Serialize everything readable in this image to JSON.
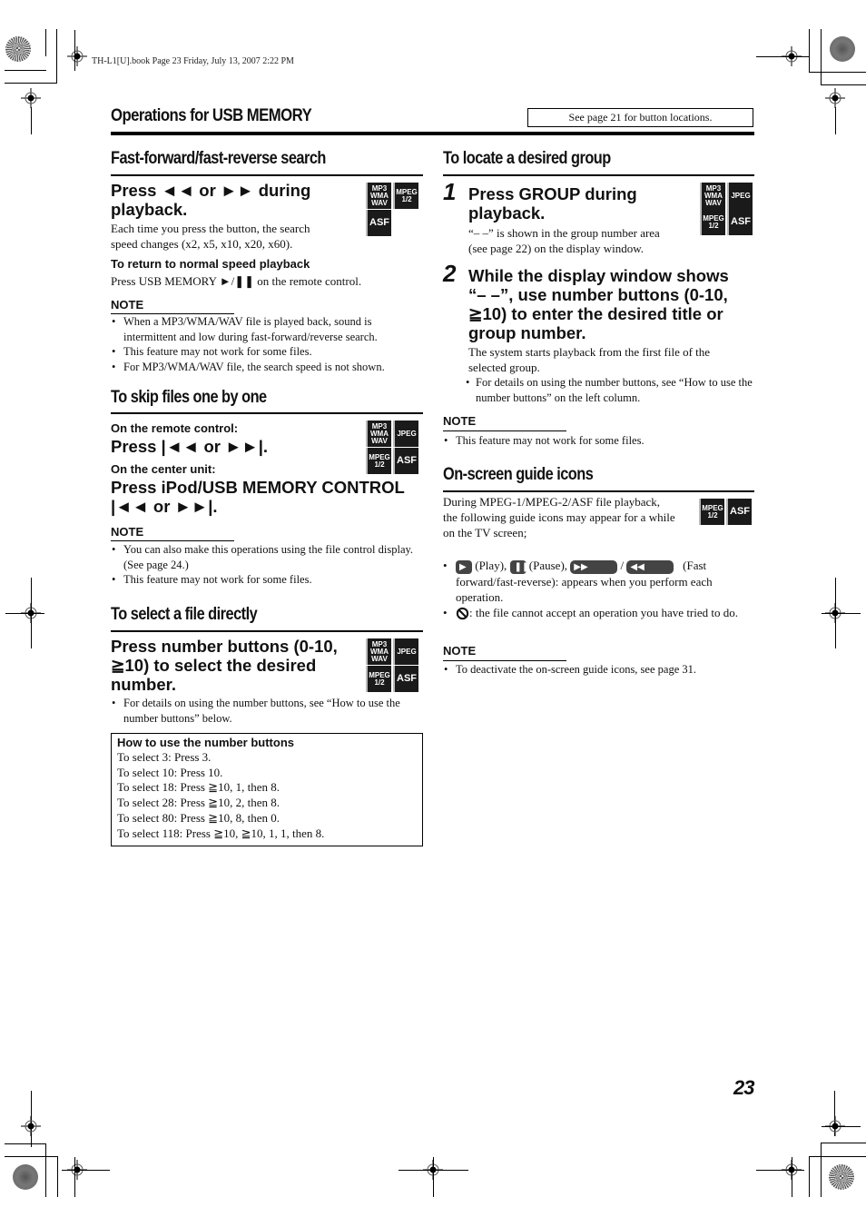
{
  "print_header": "TH-L1[U].book  Page 23  Friday, July 13, 2007  2:22 PM",
  "section_title": "Operations for USB MEMORY",
  "see_page_box": "See page 21 for button locations.",
  "page_number": "23",
  "badges": {
    "mp3": [
      "MP3",
      "WMA",
      "WAV"
    ],
    "mpeg": [
      "MPEG",
      "1/2"
    ],
    "jpeg": "JPEG",
    "asf": "ASF"
  },
  "left": {
    "ff": {
      "heading": "Fast-forward/fast-reverse search",
      "instruction_line1": "Press ◄◄ or ►► during",
      "instruction_line2": "playback.",
      "desc_line1": "Each time you press the button, the search",
      "desc_line2": "speed changes (x2, x5, x10, x20, x60).",
      "sub_label": "To return to normal speed playback",
      "sub_text": "Press USB MEMORY ►/❚❚ on the remote control.",
      "note_label": "NOTE",
      "notes": [
        "When a MP3/WMA/WAV file is played back, sound is intermittent and low during fast-forward/reverse search.",
        "This feature may not work for some files.",
        "For MP3/WMA/WAV file, the search speed is not shown."
      ]
    },
    "skip": {
      "heading": "To skip files one by one",
      "remote_label": "On the remote control:",
      "remote_instruction": "Press |◄◄ or ►►|.",
      "unit_label": "On the center unit:",
      "unit_instruction_line1": "Press iPod/USB MEMORY CONTROL",
      "unit_instruction_line2": "|◄◄ or ►►|.",
      "note_label": "NOTE",
      "notes": [
        "You can also make this operations using the file control display. (See page 24.)",
        "This feature may not work for some files."
      ]
    },
    "direct": {
      "heading": "To select a file directly",
      "instruction_line1": "Press number buttons (0-10,",
      "instruction_line2": "≧10) to select the desired",
      "instruction_line3": "number.",
      "bullet": "For details on using the number buttons, see “How to use the number buttons” below."
    },
    "howto": {
      "title": "How to use the number buttons",
      "rows": [
        "To select 3: Press 3.",
        "To select 10: Press 10.",
        "To select 18: Press ≧10, 1, then 8.",
        "To select 28: Press ≧10, 2, then 8.",
        "To select 80: Press ≧10, 8, then 0.",
        "To select 118: Press ≧10, ≧10, 1, 1, then 8."
      ]
    }
  },
  "right": {
    "group": {
      "heading": "To locate a desired group",
      "step1_num": "1",
      "step1_line1": "Press GROUP during",
      "step1_line2": "playback.",
      "step1_desc_line1": "“– –” is shown in the group number area",
      "step1_desc_line2": "(see page 22) on the display window.",
      "step2_num": "2",
      "step2_lines": [
        "While the display window shows",
        "“– –”, use number buttons (0-10,",
        "≧10) to enter the desired title or",
        "group number."
      ],
      "step2_desc_line1": "The system starts playback from the first file of the",
      "step2_desc_line2": "selected group.",
      "step2_bullet": "For details on using the number buttons, see “How to use the number buttons” on the left column.",
      "note_label": "NOTE",
      "notes": [
        "This feature may not work for some files."
      ]
    },
    "guide": {
      "heading": "On-screen guide icons",
      "desc_line1": "During MPEG-1/MPEG-2/ASF file playback,",
      "desc_line2": "the following guide icons may appear for a while",
      "desc_line3": "on the TV screen;",
      "play_label": "(Play),",
      "pause_label": "(Pause),",
      "slash": "/",
      "ff_label": "(Fast",
      "ff_cont": "forward/fast-reverse): appears when you perform each operation.",
      "prohibit_text": ": the file cannot accept an operation you have tried to do.",
      "note_label": "NOTE",
      "notes": [
        "To deactivate the on-screen guide icons, see page 31."
      ]
    }
  }
}
